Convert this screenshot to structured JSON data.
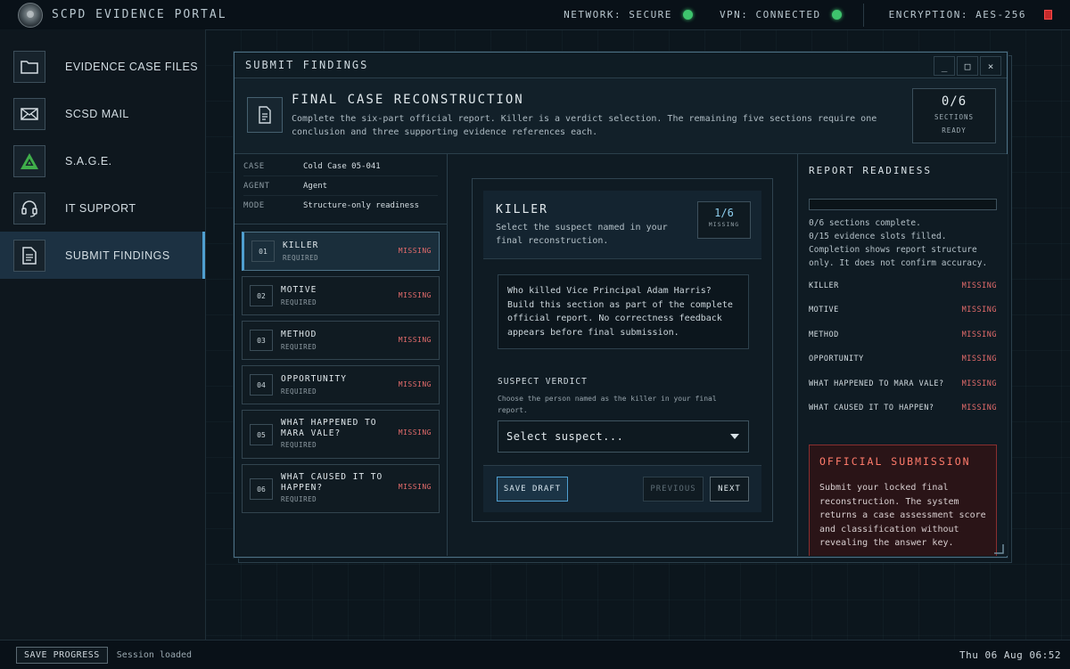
{
  "app": {
    "title": "SCPD EVIDENCE PORTAL",
    "status": [
      {
        "label": "NETWORK: SECURE",
        "color": "#3ec46d"
      },
      {
        "label": "VPN: CONNECTED",
        "color": "#3ec46d"
      }
    ],
    "encryption": "ENCRYPTION: AES-256"
  },
  "sidebar": {
    "items": [
      {
        "label": "EVIDENCE CASE FILES",
        "icon": "folder-icon"
      },
      {
        "label": "SCSD MAIL",
        "icon": "mail-icon"
      },
      {
        "label": "S.A.G.E.",
        "icon": "sage-icon"
      },
      {
        "label": "IT SUPPORT",
        "icon": "headset-icon"
      },
      {
        "label": "SUBMIT FINDINGS",
        "icon": "document-icon",
        "active": true
      }
    ]
  },
  "window": {
    "title": "SUBMIT FINDINGS",
    "controls": [
      "_",
      "□",
      "×"
    ],
    "header": {
      "title": "FINAL CASE RECONSTRUCTION",
      "description": "Complete the six-part official report. Killer is a verdict selection. The remaining five sections require one conclusion and three supporting evidence references each.",
      "ready_count": "0/6",
      "ready_label_1": "SECTIONS",
      "ready_label_2": "READY"
    }
  },
  "meta": [
    {
      "key": "CASE",
      "value": "Cold Case 05-041"
    },
    {
      "key": "AGENT",
      "value": "Agent"
    },
    {
      "key": "MODE",
      "value": "Structure-only readiness"
    }
  ],
  "sections": [
    {
      "num": "01",
      "name": "KILLER",
      "req": "REQUIRED",
      "status": "MISSING",
      "active": true
    },
    {
      "num": "02",
      "name": "MOTIVE",
      "req": "REQUIRED",
      "status": "MISSING"
    },
    {
      "num": "03",
      "name": "METHOD",
      "req": "REQUIRED",
      "status": "MISSING"
    },
    {
      "num": "04",
      "name": "OPPORTUNITY",
      "req": "REQUIRED",
      "status": "MISSING"
    },
    {
      "num": "05",
      "name": "WHAT HAPPENED TO MARA VALE?",
      "req": "REQUIRED",
      "status": "MISSING"
    },
    {
      "num": "06",
      "name": "WHAT CAUSED IT TO HAPPEN?",
      "req": "REQUIRED",
      "status": "MISSING"
    }
  ],
  "center": {
    "title": "KILLER",
    "subtitle": "Select the suspect named in your final reconstruction.",
    "count": "1/6",
    "count_label": "MISSING",
    "info": "Who killed Vice Principal Adam Harris? Build this section as part of the complete official report. No correctness feedback appears before final submission.",
    "verdict_label": "SUSPECT VERDICT",
    "verdict_help": "Choose the person named as the killer in your final report.",
    "select_value": "Select suspect...",
    "save_label": "SAVE DRAFT",
    "prev_label": "PREVIOUS",
    "next_label": "NEXT"
  },
  "readiness": {
    "title": "REPORT READINESS",
    "progress": 0,
    "stat_1": "0/6 sections complete.",
    "stat_2": "0/15 evidence slots filled.",
    "stat_3": "Completion shows report structure only. It does not confirm accuracy.",
    "rows": [
      {
        "name": "KILLER",
        "status": "MISSING"
      },
      {
        "name": "MOTIVE",
        "status": "MISSING"
      },
      {
        "name": "METHOD",
        "status": "MISSING"
      },
      {
        "name": "OPPORTUNITY",
        "status": "MISSING"
      },
      {
        "name": "WHAT HAPPENED TO MARA VALE?",
        "status": "MISSING"
      },
      {
        "name": "WHAT CAUSED IT TO HAPPEN?",
        "status": "MISSING"
      }
    ],
    "official_title": "OFFICIAL SUBMISSION",
    "official_text": "Submit your locked final reconstruction. The system returns a case assessment score and classification without revealing the answer key."
  },
  "footer": {
    "save_label": "SAVE PROGRESS",
    "session": "Session loaded",
    "clock": "Thu 06 Aug 06:52"
  },
  "colors": {
    "accent": "#4f9fd0",
    "missing": "#e36b6b",
    "secure": "#3ec46d"
  }
}
